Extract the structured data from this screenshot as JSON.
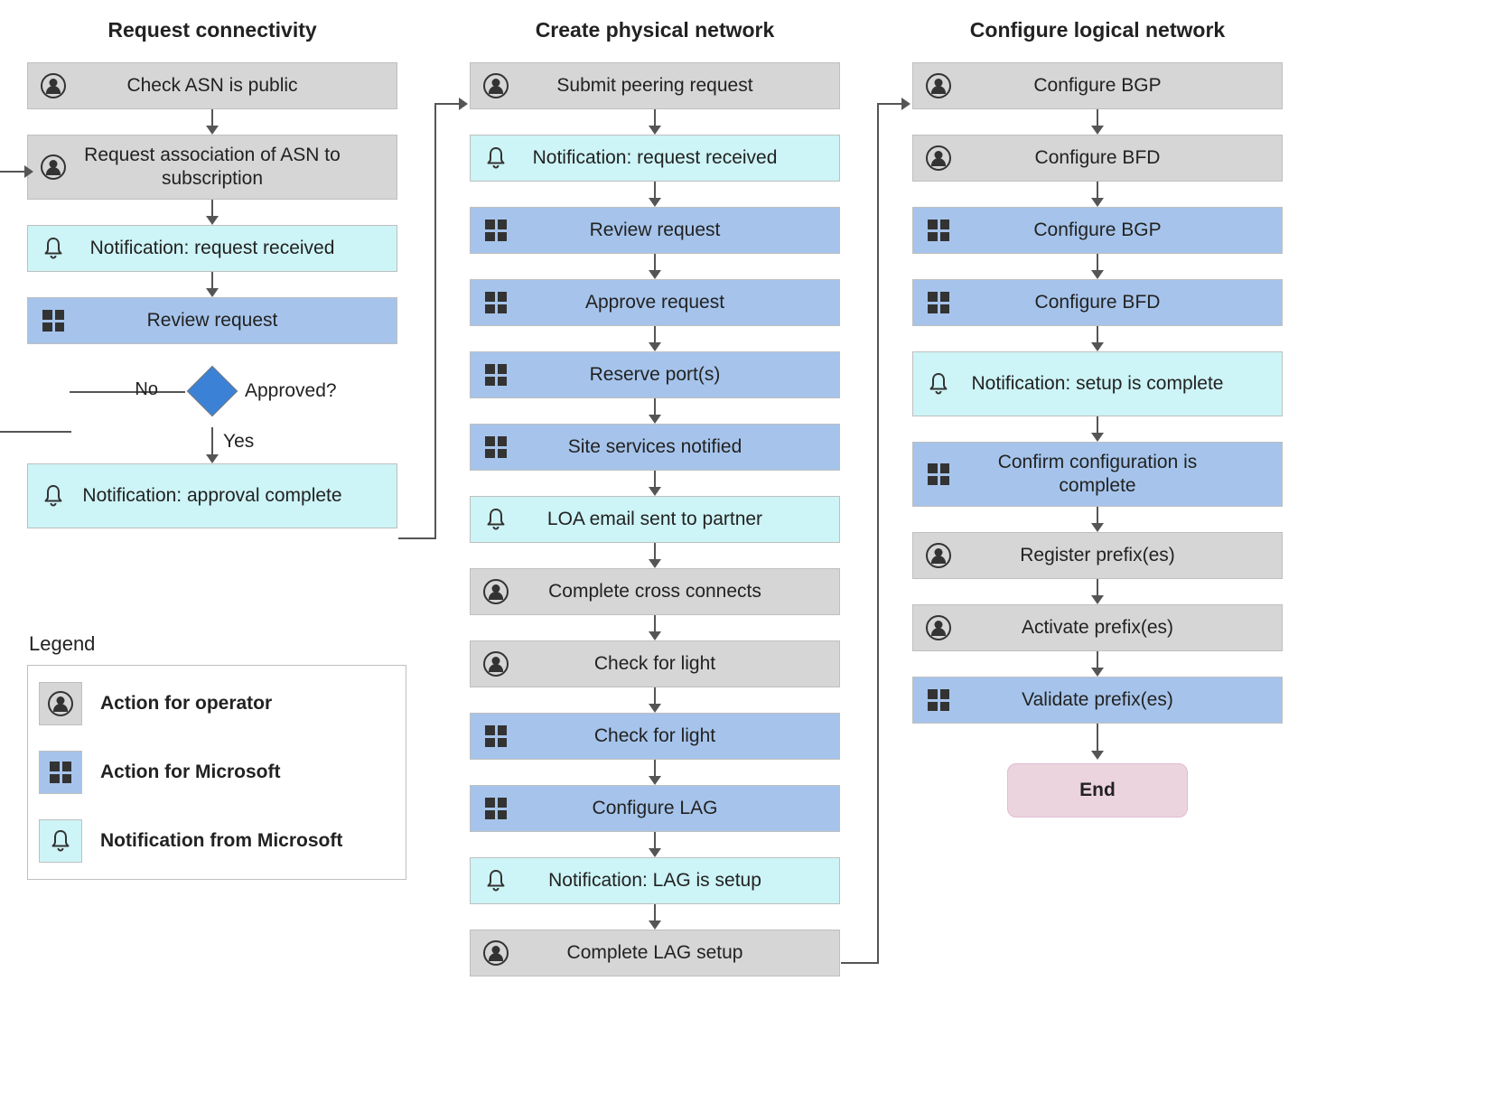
{
  "columns": {
    "c1": {
      "title": "Request connectivity"
    },
    "c2": {
      "title": "Create physical network"
    },
    "c3": {
      "title": "Configure logical network"
    }
  },
  "steps": {
    "c1": [
      {
        "label": "Check ASN is public",
        "type": "operator"
      },
      {
        "label": "Request association of ASN to subscription",
        "type": "operator"
      },
      {
        "label": "Notification: request received",
        "type": "notification"
      },
      {
        "label": "Review request",
        "type": "microsoft"
      }
    ],
    "c1_after": {
      "label": "Notification: approval complete",
      "type": "notification"
    },
    "c2": [
      {
        "label": "Submit peering request",
        "type": "operator"
      },
      {
        "label": "Notification: request received",
        "type": "notification"
      },
      {
        "label": "Review request",
        "type": "microsoft"
      },
      {
        "label": "Approve request",
        "type": "microsoft"
      },
      {
        "label": "Reserve port(s)",
        "type": "microsoft"
      },
      {
        "label": "Site services notified",
        "type": "microsoft"
      },
      {
        "label": "LOA email sent to partner",
        "type": "notification"
      },
      {
        "label": "Complete cross connects",
        "type": "operator"
      },
      {
        "label": "Check for light",
        "type": "operator"
      },
      {
        "label": "Check for light",
        "type": "microsoft"
      },
      {
        "label": "Configure LAG",
        "type": "microsoft"
      },
      {
        "label": "Notification: LAG is setup",
        "type": "notification"
      },
      {
        "label": "Complete LAG setup",
        "type": "operator"
      }
    ],
    "c3": [
      {
        "label": "Configure BGP",
        "type": "operator"
      },
      {
        "label": "Configure BFD",
        "type": "operator"
      },
      {
        "label": "Configure BGP",
        "type": "microsoft"
      },
      {
        "label": "Configure BFD",
        "type": "microsoft"
      },
      {
        "label": "Notification: setup is complete",
        "type": "notification"
      },
      {
        "label": "Confirm configuration is complete",
        "type": "microsoft"
      },
      {
        "label": "Register prefix(es)",
        "type": "operator"
      },
      {
        "label": "Activate prefix(es)",
        "type": "operator"
      },
      {
        "label": "Validate prefix(es)",
        "type": "microsoft"
      }
    ]
  },
  "decision": {
    "question": "Approved?",
    "yes": "Yes",
    "no": "No"
  },
  "end": {
    "label": "End"
  },
  "legend": {
    "title": "Legend",
    "items": [
      {
        "label": "Action for operator",
        "type": "operator"
      },
      {
        "label": "Action for Microsoft",
        "type": "microsoft"
      },
      {
        "label": "Notification from Microsoft",
        "type": "notification"
      }
    ]
  },
  "colors": {
    "operator": "#d6d6d6",
    "microsoft": "#a6c4eb",
    "notification": "#cdf4f6",
    "diamond": "#3b82d6",
    "end": "#ecd4df"
  }
}
